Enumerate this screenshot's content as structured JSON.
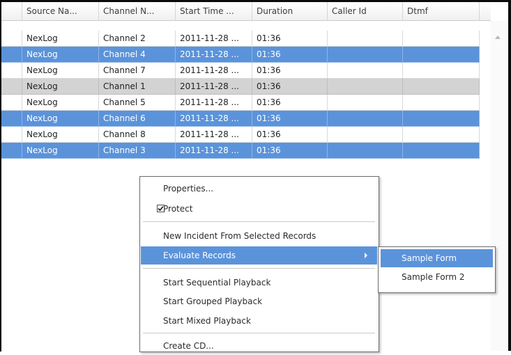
{
  "columns": [
    "Source Na...",
    "Channel N...",
    "Start Time ...",
    "Duration",
    "Caller Id",
    "Dtmf"
  ],
  "rows": [
    {
      "source": "NexLog",
      "channel": "Channel 2",
      "start": "2011-11-28 ...",
      "duration": "01:36",
      "caller_id": "",
      "dtmf": "",
      "state": "plain"
    },
    {
      "source": "NexLog",
      "channel": "Channel 4",
      "start": "2011-11-28 ...",
      "duration": "01:36",
      "caller_id": "",
      "dtmf": "",
      "state": "selected"
    },
    {
      "source": "NexLog",
      "channel": "Channel 7",
      "start": "2011-11-28 ...",
      "duration": "01:36",
      "caller_id": "",
      "dtmf": "",
      "state": "plain"
    },
    {
      "source": "NexLog",
      "channel": "Channel 1",
      "start": "2011-11-28 ...",
      "duration": "01:36",
      "caller_id": "",
      "dtmf": "",
      "state": "focused"
    },
    {
      "source": "NexLog",
      "channel": "Channel 5",
      "start": "2011-11-28 ...",
      "duration": "01:36",
      "caller_id": "",
      "dtmf": "",
      "state": "plain"
    },
    {
      "source": "NexLog",
      "channel": "Channel 6",
      "start": "2011-11-28 ...",
      "duration": "01:36",
      "caller_id": "",
      "dtmf": "",
      "state": "selected"
    },
    {
      "source": "NexLog",
      "channel": "Channel 8",
      "start": "2011-11-28 ...",
      "duration": "01:36",
      "caller_id": "",
      "dtmf": "",
      "state": "plain"
    },
    {
      "source": "NexLog",
      "channel": "Channel 3",
      "start": "2011-11-28 ...",
      "duration": "01:36",
      "caller_id": "",
      "dtmf": "",
      "state": "selected"
    }
  ],
  "context_menu": {
    "properties": "Properties...",
    "protect": "Protect",
    "protect_checked": true,
    "new_incident": "New Incident From Selected Records",
    "evaluate_records": "Evaluate Records",
    "start_sequential": "Start Sequential Playback",
    "start_grouped": "Start Grouped Playback",
    "start_mixed": "Start Mixed Playback",
    "create_cd": "Create CD..."
  },
  "submenu": {
    "items": [
      "Sample Form",
      "Sample Form 2"
    ],
    "highlighted": "Sample Form"
  },
  "colors": {
    "selection": "#5b93da",
    "focused_row": "#d3d3d3"
  },
  "icons": [
    "checkbox-checked-icon",
    "submenu-arrow-icon",
    "scroll-up-arrow-icon"
  ]
}
